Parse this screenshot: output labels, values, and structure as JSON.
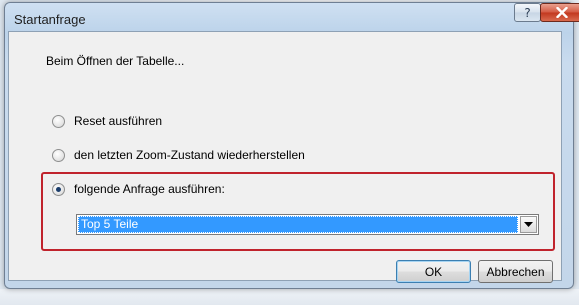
{
  "dialog": {
    "title": "Startanfrage",
    "help_glyph": "?",
    "close_glyph": "x"
  },
  "content": {
    "intro": "Beim Öffnen der Tabelle...",
    "options": [
      {
        "label": "Reset ausführen",
        "checked": false
      },
      {
        "label": "den letzten Zoom-Zustand wiederherstellen",
        "checked": false
      },
      {
        "label": "folgende Anfrage ausführen:",
        "checked": true
      }
    ],
    "query_select": {
      "value": "Top 5 Teile"
    }
  },
  "buttons": {
    "ok": "OK",
    "cancel": "Abbrechen"
  },
  "icons": {
    "help": "question-icon",
    "close": "close-icon",
    "dropdown": "chevron-down-icon"
  },
  "colors": {
    "highlight_frame": "#c0232c",
    "selection": "#3399ff",
    "close_button": "#c2381f"
  }
}
